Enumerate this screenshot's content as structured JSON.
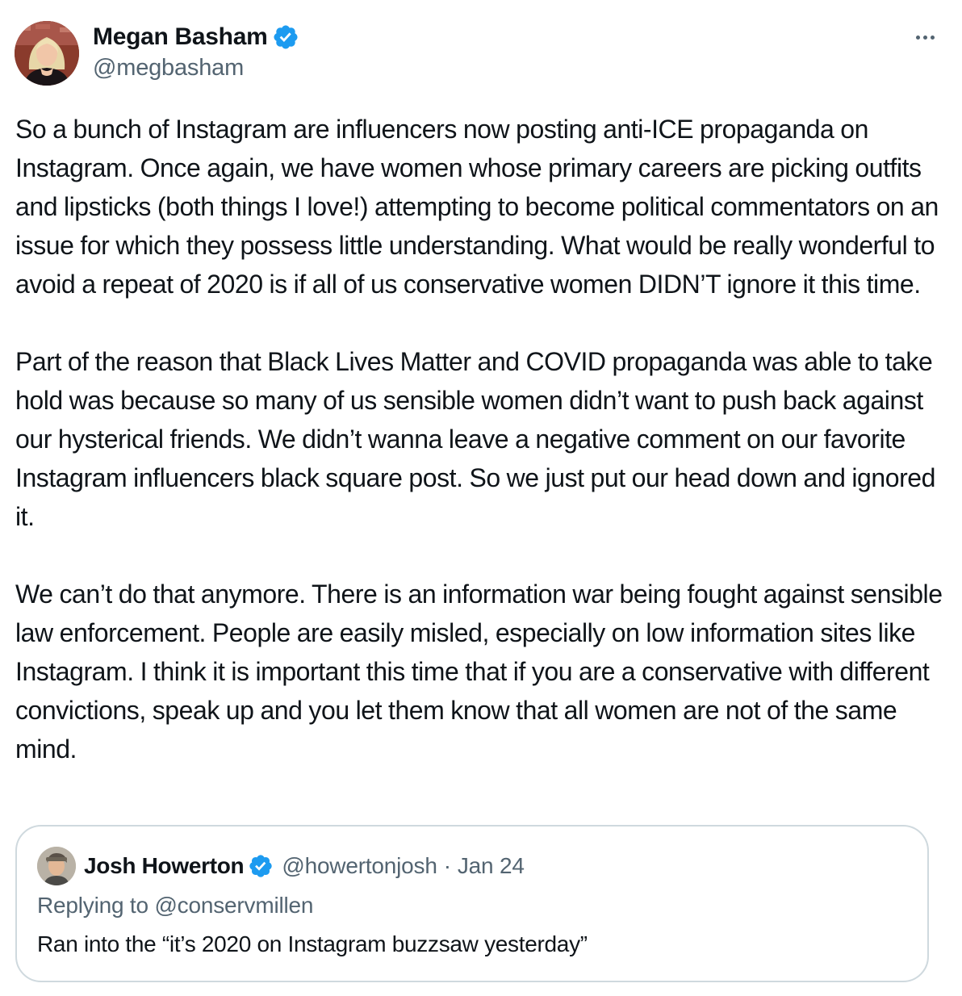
{
  "tweet": {
    "author": {
      "display_name": "Megan Basham",
      "handle": "@megbasham",
      "verified": true,
      "avatar_icon": "user-avatar"
    },
    "more_icon": "more-options-icon",
    "paragraphs": [
      "So a bunch of Instagram are influencers now posting anti-ICE propaganda on Instagram. Once again, we have women whose primary careers are picking outfits and lipsticks (both things I love!) attempting to become political commentators on an issue for which they possess little understanding. What would be really wonderful to avoid a repeat of 2020 is if all of us conservative women DIDN’T ignore it this time.",
      "Part of the reason that Black Lives Matter and COVID propaganda was able to take hold was because so many of us sensible women didn’t want to push back against our hysterical friends. We didn’t wanna leave a negative comment on our favorite Instagram influencers black square post. So we just put our head down and ignored it.",
      "We can’t do that anymore. There is an information war being fought against sensible law enforcement. People are easily misled, especially on low information sites like Instagram. I think it is important this time that if you are a conservative with different convictions, speak up and you let them know that all women are not of the same mind."
    ]
  },
  "quoted": {
    "display_name": "Josh Howerton",
    "handle": "@howertonjosh",
    "separator": "·",
    "date": "Jan 24",
    "verified": true,
    "replying_to": "Replying to @conservmillen",
    "text": "Ran into the “it’s 2020 on Instagram buzzsaw yesterday”"
  },
  "colors": {
    "text": "#0f1419",
    "secondary": "#536471",
    "verified_blue": "#1d9bf0",
    "border": "#cfd9de"
  }
}
